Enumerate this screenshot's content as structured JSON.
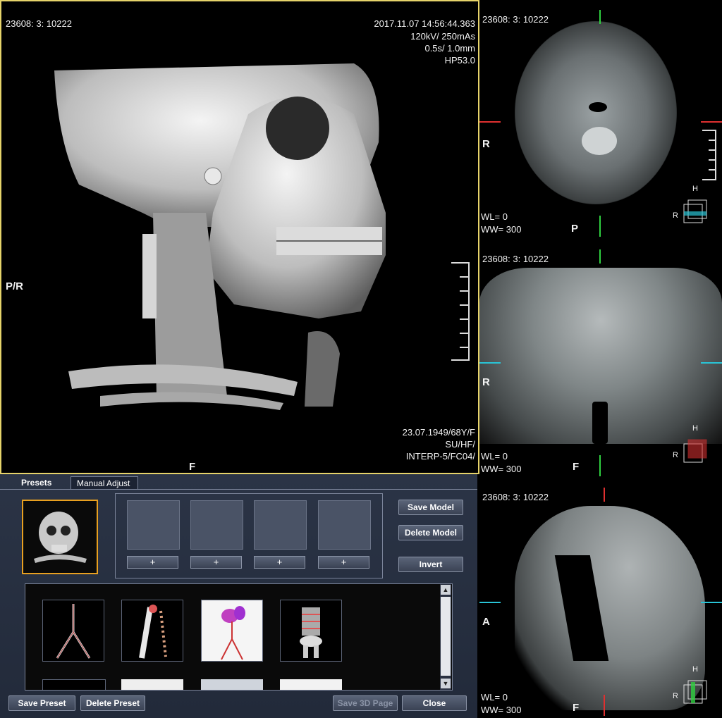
{
  "volume_view": {
    "series_id": "23608: 3: 10222",
    "datetime": "2017.11.07  14:56:44.363",
    "kv_mas": "120kV/ 250mAs",
    "slice": "0.5s/ 1.0mm",
    "hp": "HP53.0",
    "orientation_left": "P/R",
    "orientation_bottom": "F",
    "patient_line1": "23.07.1949/68Y/F",
    "patient_line2": "SU/HF/",
    "patient_line3": "INTERP-5/FC04/"
  },
  "axial_view": {
    "series_id": "23608: 3: 10222",
    "orientation_left": "R",
    "orientation_bottom": "P",
    "wl": "WL= 0",
    "ww": "WW= 300",
    "cube_top": "H",
    "cube_left": "R",
    "marker_color": "#e03030"
  },
  "coronal_view": {
    "series_id": "23608: 3: 10222",
    "orientation_left": "R",
    "orientation_bottom": "F",
    "wl": "WL= 0",
    "ww": "WW= 300",
    "cube_top": "H",
    "cube_left": "R",
    "marker_color": "#29c4d6"
  },
  "sagittal_view": {
    "series_id": "23608: 3: 10222",
    "orientation_left": "A",
    "orientation_bottom": "F",
    "wl": "WL= 0",
    "ww": "WW= 300",
    "cube_top": "H",
    "cube_left": "R",
    "marker_color": "#29c4d6"
  },
  "control_panel": {
    "tabs": [
      {
        "label": "Presets"
      },
      {
        "label": "Manual Adjust"
      }
    ],
    "slot_add_labels": [
      "+",
      "+",
      "+",
      "+"
    ],
    "buttons": {
      "save_model": "Save Model",
      "delete_model": "Delete Model",
      "invert": "Invert",
      "save_preset": "Save Preset",
      "delete_preset": "Delete Preset",
      "save_3d_page": "Save 3D Page",
      "close": "Close"
    },
    "preset_icons": [
      "vessel-preset-icon",
      "skeleton-vessel-preset-icon",
      "contrast-vessel-preset-icon",
      "bone-preset-icon"
    ],
    "scroll_up": "▲",
    "scroll_down": "▼"
  },
  "colors": {
    "active_border": "#e6d36a",
    "selected_preset_border": "#e8a020",
    "green_marker": "#2fd040",
    "red_marker": "#e03030",
    "cyan_marker": "#29c4d6"
  }
}
